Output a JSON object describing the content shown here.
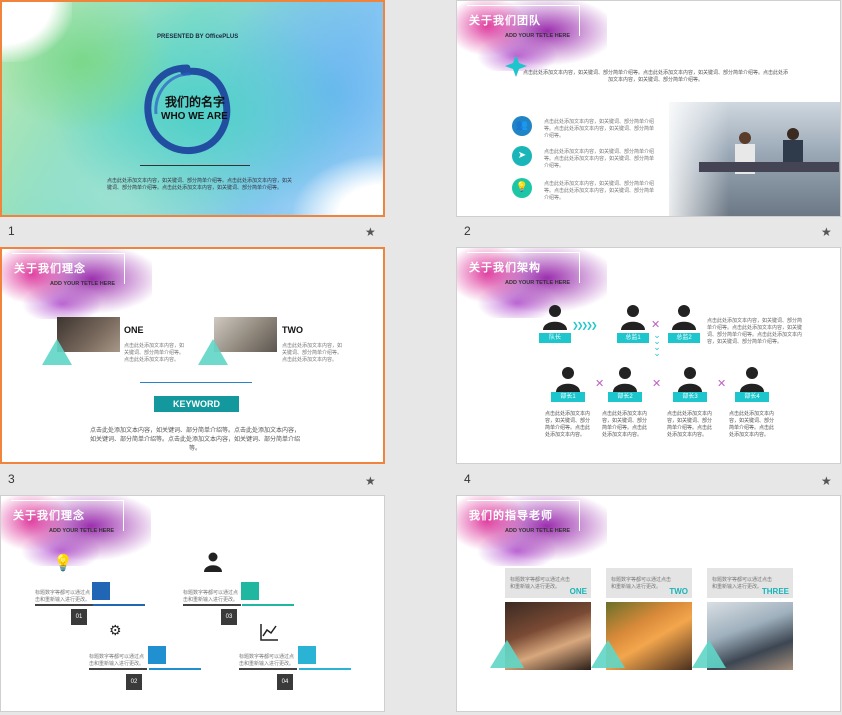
{
  "thumbnails": [
    {
      "number": "1"
    },
    {
      "number": "2"
    },
    {
      "number": "3"
    },
    {
      "number": "4"
    },
    {
      "number": "5"
    },
    {
      "number": "6"
    }
  ],
  "colors": {
    "accent": "#19b5b9",
    "selection": "#f0843c",
    "cyan": "#1cc6cc",
    "purple": "#9b2fae",
    "magenta": "#e040a0"
  },
  "slide1": {
    "presented": "PRESENTED BY OfficePLUS",
    "title_cn": "我们的名字",
    "title_en": "WHO WE ARE",
    "body": "点击此处添加文本内容，如关键词、部分简单介绍等。点击此处添加文本内容，如关键词、部分简单介绍等。点击此处添加文本内容，如关键词、部分简单介绍等。"
  },
  "slide2": {
    "title": "关于我们团队",
    "subtitle": "ADD YOUR TETLE HERE",
    "intro": "点击此处添加文本内容，如关键词、部分简单介绍等。点击此处添加文本内容，如关键词、部分简单介绍等。点击此处添加文本内容，如关键词、部分简单介绍等。",
    "items": [
      {
        "icon": "team-icon",
        "text": "点击此处添加文本内容，如关键词、部分简单介绍等。点击此处添加文本内容，如关键词、部分简单介绍等。"
      },
      {
        "icon": "paper-plane-icon",
        "text": "点击此处添加文本内容，如关键词、部分简单介绍等。点击此处添加文本内容，如关键词、部分简单介绍等。"
      },
      {
        "icon": "lightbulb-icon",
        "text": "点击此处添加文本内容，如关键词、部分简单介绍等。点击此处添加文本内容，如关键词、部分简单介绍等。"
      }
    ]
  },
  "slide3": {
    "title": "关于我们理念",
    "subtitle": "ADD YOUR TETLE HERE",
    "one_label": "ONE",
    "one_text": "点击此处添加文本内容，如关键词、部分简单介绍等。点击此处添加文本内容。",
    "two_label": "TWO",
    "two_text": "点击此处添加文本内容，如关键词、部分简单介绍等。点击此处添加文本内容。",
    "keyword": "KEYWORD",
    "body": "点击此处添加文本内容，如关键词、部分简单介绍等。点击此处添加文本内容，如关键词、部分简单介绍等。点击此处添加文本内容，如关键词、部分简单介绍等。"
  },
  "slide4": {
    "title": "关于我们架构",
    "subtitle": "ADD YOUR TETLE HERE",
    "leader": "队长",
    "directors": [
      "总监1",
      "总监2"
    ],
    "side_text": "点击此处添加文本内容，如关键词、部分简单介绍等。点击此处添加文本内容，如关键词、部分简单介绍等。点击此处添加文本内容，如关键词、部分简单介绍等。",
    "ministers": [
      "部长1",
      "部长2",
      "部长3",
      "部长4"
    ],
    "minister_text": "点击此处添加文本内容，如关键词、部分简单介绍等。点击此处添加文本内容。"
  },
  "slide5": {
    "title": "关于我们理念",
    "subtitle": "ADD YOUR TETLE HERE",
    "items": [
      {
        "num": "01",
        "icon": "lightbulb-icon",
        "text": "标题数字等都可以通过点击和重新输入进行更改。"
      },
      {
        "num": "02",
        "icon": "network-icon",
        "text": "标题数字等都可以通过点击和重新输入进行更改。"
      },
      {
        "num": "03",
        "icon": "person-icon",
        "text": "标题数字等都可以通过点击和重新输入进行更改。"
      },
      {
        "num": "04",
        "icon": "chart-icon",
        "text": "标题数字等都可以通过点击和重新输入进行更改。"
      }
    ]
  },
  "slide6": {
    "title": "我们的指导老师",
    "subtitle": "ADD YOUR TETLE HERE",
    "cards": [
      {
        "label": "ONE",
        "text": "标题数字等都可以通过点击和重新输入进行更改。"
      },
      {
        "label": "TWO",
        "text": "标题数字等都可以通过点击和重新输入进行更改。"
      },
      {
        "label": "THREE",
        "text": "标题数字等都可以通过点击和重新输入进行更改。"
      }
    ]
  }
}
